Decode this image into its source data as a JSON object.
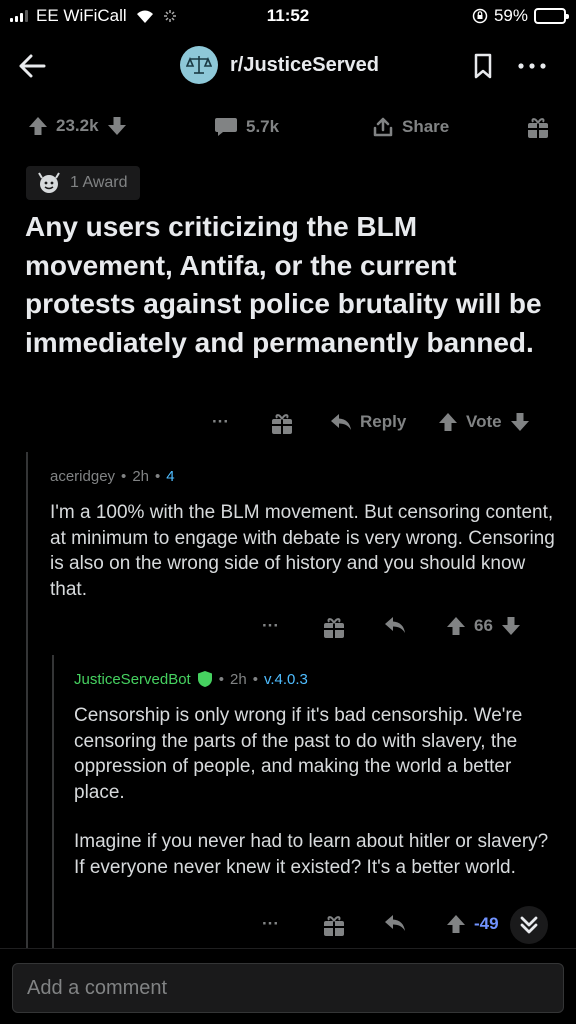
{
  "status_bar": {
    "carrier": "EE WiFiCall",
    "time": "11:52",
    "battery": "59%",
    "battery_level": 0.59
  },
  "header": {
    "subreddit": "r/JusticeServed",
    "icons": [
      "back-arrow-icon",
      "scales-icon",
      "bookmark-icon",
      "more-icon"
    ]
  },
  "post": {
    "upvotes": "23.2k",
    "comments": "5.7k",
    "share_label": "Share",
    "award_label": "1 Award",
    "title": "Any users criticizing the BLM movement, Antifa, or the current protests against police brutality will be immediately and permanently banned.",
    "reply_label": "Reply",
    "vote_label": "Vote",
    "more": "···"
  },
  "comments": [
    {
      "author": "aceridgey",
      "time": "2h",
      "extra": "4",
      "body": [
        "I'm a 100% with the BLM movement. But censoring content, at minimum to engage with debate is very wrong. Censoring is also on the wrong side of history and you should know that."
      ],
      "score": "66",
      "more": "···"
    },
    {
      "author": "JusticeServedBot",
      "time": "2h",
      "version": "v.4.0.3",
      "body": [
        "Censorship is only wrong if it's bad censorship. We're censoring the parts of the past to do with slavery, the oppression of people, and making the world a better place.",
        "Imagine if you never had to learn about hitler or slavery? If everyone never knew it existed? It's a better world."
      ],
      "score": "-49",
      "more": "···"
    }
  ],
  "bottom": {
    "comment_placeholder": "Add a comment"
  },
  "colors": {
    "background": "#000000",
    "text": "#d7dadc",
    "muted": "#818384",
    "bot_author": "#46d160",
    "link_blue": "#4fbdff"
  }
}
